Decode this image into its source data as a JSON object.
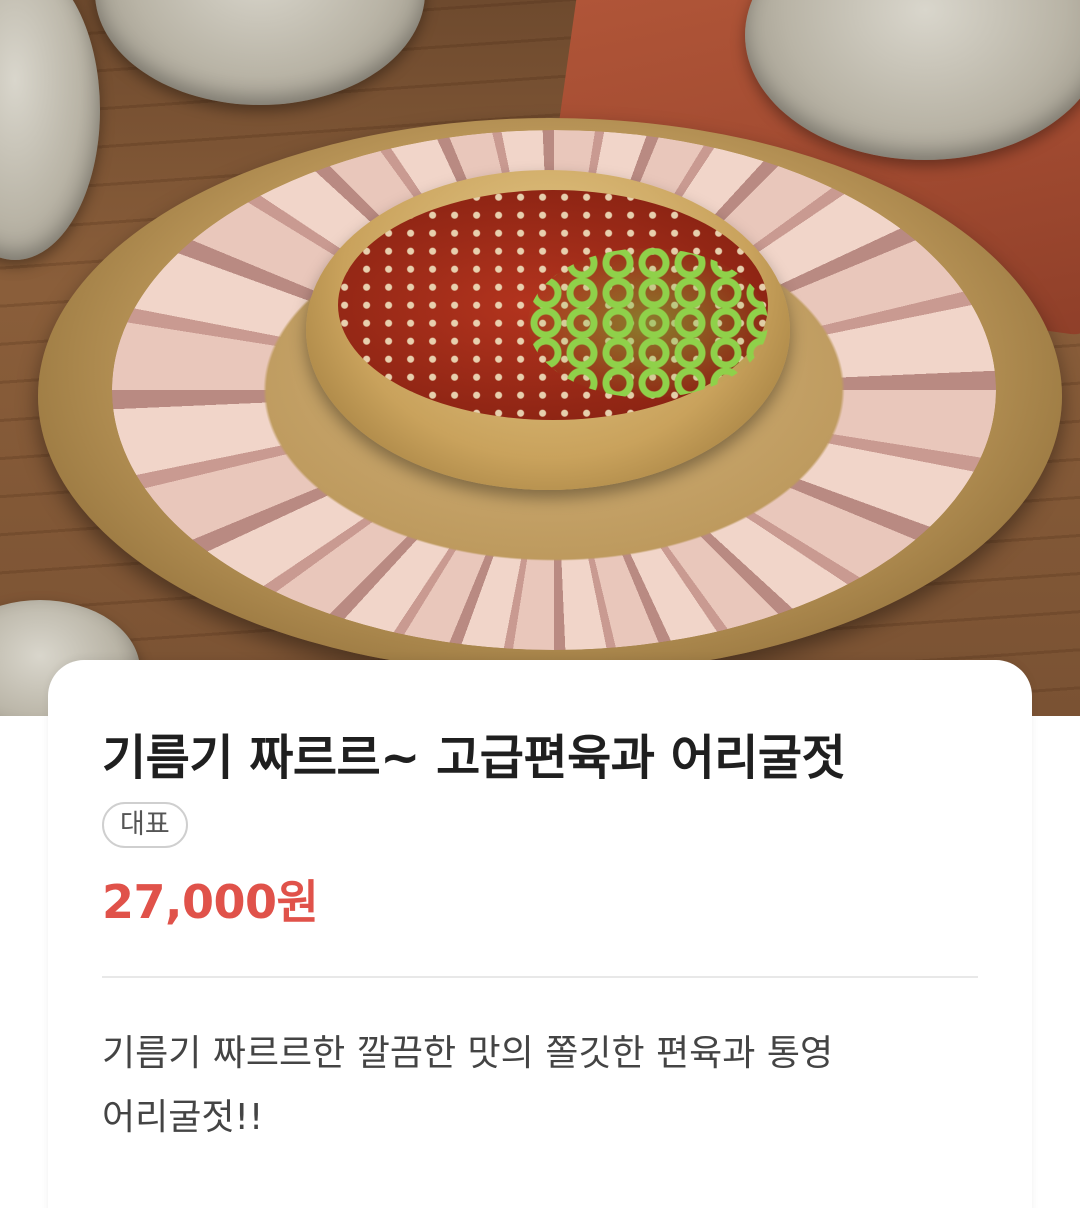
{
  "hero_image": {
    "alt": ""
  },
  "product": {
    "title": "기름기 짜르르~ 고급편육과 어리굴젓",
    "badge": "대표",
    "price": "27,000원",
    "description": "기름기 짜르르한 깔끔한 맛의 쫄깃한 편육과 통영 어리굴젓!!"
  },
  "colors": {
    "price": "#e0524a",
    "title": "#1f1f1f",
    "description": "#444444",
    "badge_border": "#cfcfcf",
    "divider": "#e8e8e8"
  }
}
